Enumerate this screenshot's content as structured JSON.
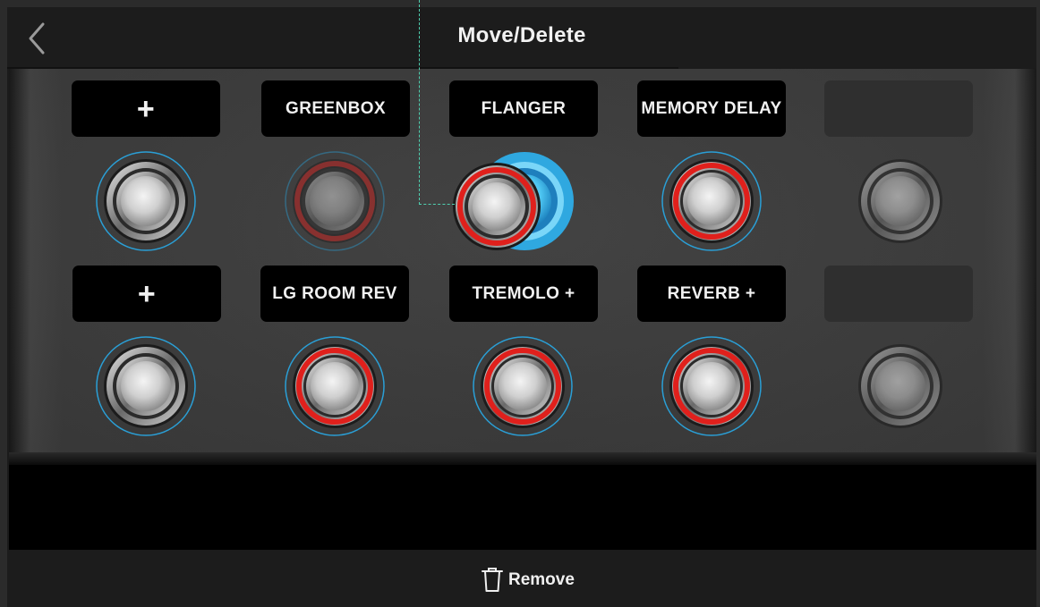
{
  "header": {
    "title": "Move/Delete",
    "back_icon": "chevron-left-icon"
  },
  "row1": [
    {
      "label": "+",
      "type": "add",
      "led": "off",
      "selected": true
    },
    {
      "label": "GREENBOX",
      "type": "effect",
      "led": "red-dim",
      "selected": true
    },
    {
      "label": "FLANGER",
      "type": "effect",
      "led": "red",
      "selected": false,
      "dragging": true
    },
    {
      "label": "MEMORY DELAY",
      "type": "effect",
      "led": "red",
      "selected": true
    },
    {
      "label": "",
      "type": "empty",
      "led": "off",
      "selected": false
    }
  ],
  "row2": [
    {
      "label": "+",
      "type": "add",
      "led": "off",
      "selected": true
    },
    {
      "label": "LG ROOM REV",
      "type": "effect",
      "led": "red",
      "selected": true
    },
    {
      "label": "TREMOLO +",
      "type": "effect",
      "led": "red",
      "selected": true
    },
    {
      "label": "REVERB +",
      "type": "effect",
      "led": "red",
      "selected": true
    },
    {
      "label": "",
      "type": "empty",
      "led": "off",
      "selected": false
    }
  ],
  "footer": {
    "remove_label": "Remove",
    "remove_icon": "trash-icon"
  },
  "colors": {
    "led_red": "#e0201c",
    "select_ring": "#2a9fd6",
    "drag_blue": "#3ab6ea",
    "drag_line": "#4fd0b0"
  }
}
